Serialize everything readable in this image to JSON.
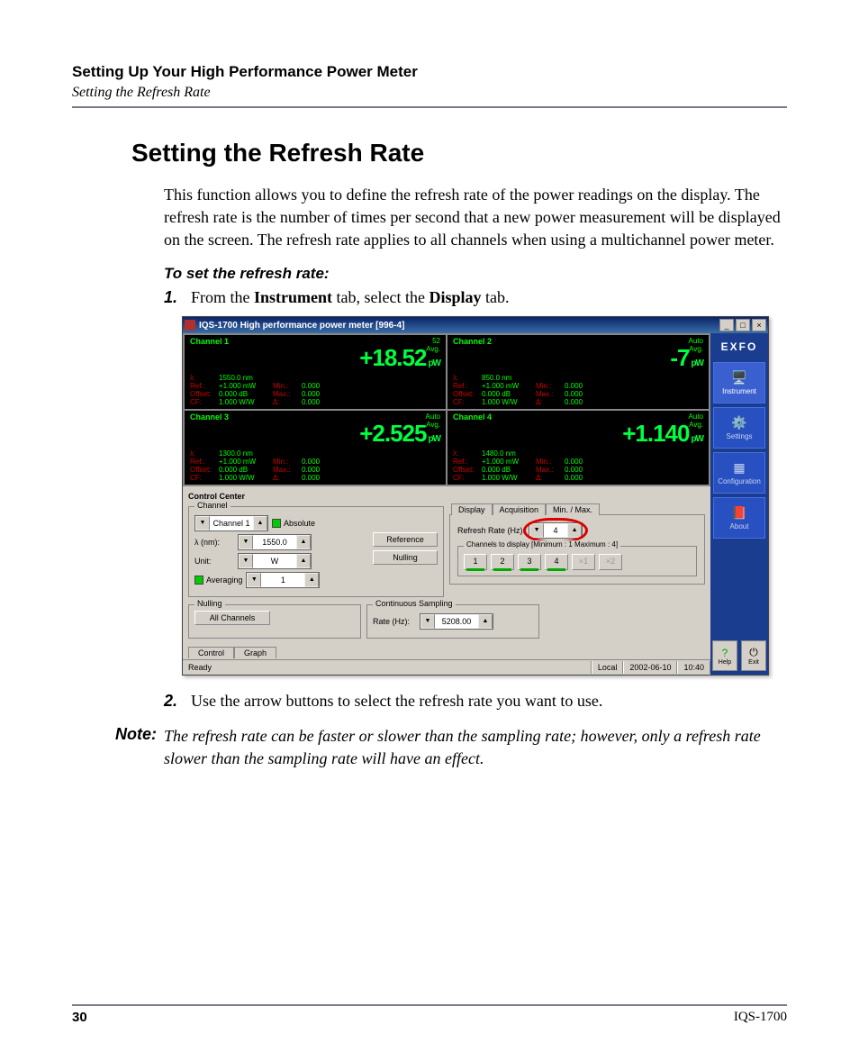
{
  "header": {
    "title": "Setting Up Your High Performance Power Meter",
    "sub": "Setting the Refresh Rate"
  },
  "heading": "Setting the Refresh Rate",
  "intro": "This function allows you to define the refresh rate of the power readings on the display. The refresh rate is the number of times per second that a new power measurement will be displayed on the screen. The refresh rate applies to all channels when using a multichannel power meter.",
  "proc_head": "To set the refresh rate:",
  "steps": {
    "1": {
      "num": "1.",
      "pre": "From the ",
      "b1": "Instrument",
      "mid": " tab, select the ",
      "b2": "Display",
      "post": " tab."
    },
    "2": {
      "num": "2.",
      "text": "Use the arrow buttons to select the refresh rate you want to use."
    }
  },
  "note": {
    "label": "Note:",
    "text": "The refresh rate can be faster or slower than the sampling rate; however, only a refresh rate slower than the sampling rate will have an effect."
  },
  "footer": {
    "page": "30",
    "model": "IQS-1700"
  },
  "app": {
    "title": "IQS-1700 High performance power meter [996-4]",
    "brand": "EXFO",
    "winbtns": {
      "min": "_",
      "max": "□",
      "close": "×"
    },
    "sidebar": {
      "instrument": "Instrument",
      "settings": "Settings",
      "configuration": "Configuration",
      "about": "About",
      "help": "Help",
      "exit": "Exit"
    },
    "channels": {
      "c1": {
        "title": "Channel 1",
        "meta_top": "52",
        "meta_bot": "Avg.",
        "value": "+18.52",
        "unit": "pW",
        "lambda_lbl": "λ:",
        "lambda": "1550.0 nm",
        "ref_lbl": "Ref.:",
        "ref": "+1.000 mW",
        "off_lbl": "Offset:",
        "off": "0.000 dB",
        "cf_lbl": "CF:",
        "cf": "1.000 W/W",
        "min_lbl": "Min.:",
        "min": "0.000",
        "max_lbl": "Max.:",
        "max": "0.000",
        "d_lbl": "Δ:",
        "d": "0.000"
      },
      "c2": {
        "title": "Channel 2",
        "meta_top": "Auto",
        "meta_bot": "Avg.",
        "value": "-7",
        "unit": "pW",
        "lambda_lbl": "λ:",
        "lambda": "850.0 nm",
        "ref_lbl": "Ref.:",
        "ref": "+1.000 mW",
        "off_lbl": "Offset:",
        "off": "0.000 dB",
        "cf_lbl": "CF:",
        "cf": "1.000 W/W",
        "min_lbl": "Min.:",
        "min": "0.000",
        "max_lbl": "Max.:",
        "max": "0.000",
        "d_lbl": "Δ:",
        "d": "0.000"
      },
      "c3": {
        "title": "Channel 3",
        "meta_top": "Auto",
        "meta_bot": "Avg.",
        "value": "+2.525",
        "unit": "pW",
        "lambda_lbl": "λ:",
        "lambda": "1300.0 nm",
        "ref_lbl": "Ref.:",
        "ref": "+1.000 mW",
        "off_lbl": "Offset:",
        "off": "0.000 dB",
        "cf_lbl": "CF:",
        "cf": "1.000 W/W",
        "min_lbl": "Min.:",
        "min": "0.000",
        "max_lbl": "Max.:",
        "max": "0.000",
        "d_lbl": "Δ:",
        "d": "0.000"
      },
      "c4": {
        "title": "Channel 4",
        "meta_top": "Auto",
        "meta_bot": "Avg.",
        "value": "+1.140",
        "unit": "pW",
        "lambda_lbl": "λ:",
        "lambda": "1480.0 nm",
        "ref_lbl": "Ref.:",
        "ref": "+1.000 mW",
        "off_lbl": "Offset:",
        "off": "0.000 dB",
        "cf_lbl": "CF:",
        "cf": "1.000 W/W",
        "min_lbl": "Min.:",
        "min": "0.000",
        "max_lbl": "Max.:",
        "max": "0.000",
        "d_lbl": "Δ:",
        "d": "0.000"
      }
    },
    "cc_title": "Control Center",
    "channel_panel": {
      "legend": "Channel",
      "selector": "Channel 1",
      "absolute": "Absolute",
      "lambda_lbl": "λ  (nm):",
      "lambda_val": "1550.0",
      "unit_lbl": "Unit:",
      "unit_val": "W",
      "averaging_lbl": "Averaging",
      "averaging_val": "1",
      "reference_btn": "Reference",
      "nulling_btn": "Nulling"
    },
    "display_panel": {
      "tabs": {
        "display": "Display",
        "acquisition": "Acquisition",
        "minmax": "Min. / Max."
      },
      "refresh_lbl": "Refresh Rate (Hz):",
      "refresh_val": "4",
      "channels_disp_legend": "Channels to display [Minimum : 1  Maximum : 4]",
      "btns": {
        "b1": "1",
        "b2": "2",
        "b3": "3",
        "b4": "4",
        "bx1": "×1",
        "bx2": "×2"
      }
    },
    "nulling_panel": {
      "legend": "Nulling",
      "all": "All Channels"
    },
    "cont_panel": {
      "legend": "Continuous Sampling",
      "rate_lbl": "Rate (Hz):",
      "rate_val": "5208.00"
    },
    "bottom_tabs": {
      "control": "Control",
      "graph": "Graph"
    },
    "status": {
      "ready": "Ready",
      "local": "Local",
      "date": "2002-06-10",
      "time": "10:40"
    }
  }
}
